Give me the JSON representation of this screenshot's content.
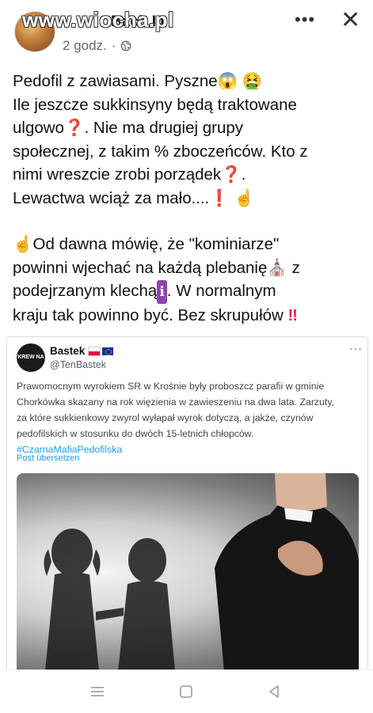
{
  "header": {
    "watermark": "www.wiocha.pl",
    "author": "Bach III",
    "time": "2 godz.",
    "separator": "·"
  },
  "post": {
    "paragraph1": {
      "line1": "Pedofil z zawiasami. Pyszne",
      "emoji1": "😱",
      "emoji2": "🤮",
      "line2": " Ile jeszcze sukkinsyny będą traktowane",
      "line3": "ulgowo",
      "emoji3": "❓",
      "line3b": ". Nie ma drugiej grupy",
      "line4": "społecznej, z takim % zboczeńców. Kto z",
      "line5": "nimi wreszcie zrobi porządek",
      "emoji4": "❓",
      "line5b": ".",
      "line6": "Lewactwa wciąż za mało....",
      "emoji5": "❗",
      "emoji6": "☝"
    },
    "paragraph2": {
      "emoji1": "☝",
      "line1": "Od dawna mówię, że \"kominiarze\"",
      "line2": "powinni wjechać na każdą plebanię",
      "emoji2": "⛪",
      "line2b": " z",
      "line3": "podejrzanym klechą",
      "emoji3": "ℹ",
      "line3b": ". W normalnym",
      "line4": "kraju tak powinno być. Bez skrupułów ",
      "emoji4": "‼"
    }
  },
  "tweet": {
    "avatar_text": "KREW NA TACY",
    "name": "Bastek",
    "handle": "@TenBastek",
    "more": "···",
    "text_line1": "Prawomocnym wyrokiem SR w Krośnie były proboszcz parafii w gminie",
    "text_line2": "Chorkówka skazany na rok więzienia w zawieszeniu na dwa lata. Zarzuty,",
    "text_line3": "za które sukkienkowy zwyrol wyłapał wyrok dotyczą, a jakże, czynów",
    "text_line4": "pedofilskich w stosunku do dwóch 15-letnich chłopców.",
    "hashtag": "#CzarnaMafiaPedofilska",
    "translate": "Post übersetzen"
  },
  "icons": {
    "globe": "globe-icon",
    "more": "more-dots-icon",
    "close": "close-icon",
    "nav_menu": "menu-icon",
    "nav_home": "home-square-icon",
    "nav_back": "back-triangle-icon"
  },
  "colors": {
    "hashtag": "#1d9bf0",
    "meta_gray": "#65676b",
    "nav_icon": "#9a9a9a"
  }
}
